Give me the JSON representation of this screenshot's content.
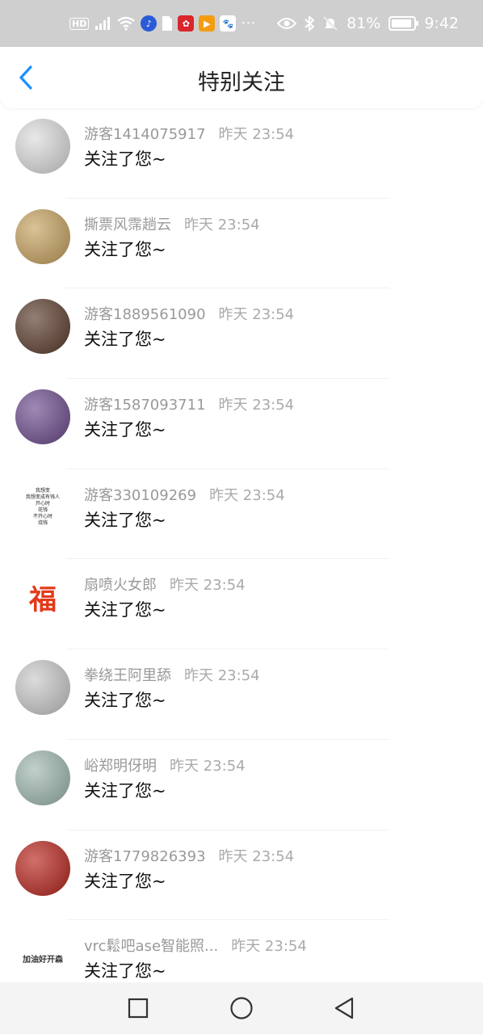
{
  "status_bar": {
    "left_icons": [
      "hd-icon",
      "signal-icon",
      "wifi-icon",
      "music-app-icon",
      "sim-icon",
      "huawei-app-icon",
      "video-app-icon",
      "baidu-app-icon"
    ],
    "hd_label": "HD",
    "more": "···",
    "battery": "81%",
    "time": "9:42"
  },
  "header": {
    "title": "特别关注"
  },
  "follows": [
    {
      "name": "游客1414075917",
      "time": "昨天 23:54",
      "message": "关注了您~",
      "avatar_color": "#dcdcdc"
    },
    {
      "name": "撕票风霈趟云",
      "time": "昨天 23:54",
      "message": "关注了您~",
      "avatar_color": "#c7a25e"
    },
    {
      "name": "游客1889561090",
      "time": "昨天 23:54",
      "message": "关注了您~",
      "avatar_color": "#5a3a2a"
    },
    {
      "name": "游客1587093711",
      "time": "昨天 23:54",
      "message": "关注了您~",
      "avatar_color": "#6b4a8c"
    },
    {
      "name": "游客330109269",
      "time": "昨天 23:54",
      "message": "关注了您~",
      "avatar_color": "#ffffff",
      "avatar_text": [
        "我想变",
        "我想变成有钱人",
        "开心时",
        "花钱",
        "不开心时",
        "烧钱"
      ]
    },
    {
      "name": "扇喷火女郎",
      "time": "昨天 23:54",
      "message": "关注了您~",
      "avatar_color": "#ffffff",
      "avatar_text": [
        "福"
      ]
    },
    {
      "name": "拳绕王阿里舔",
      "time": "昨天 23:54",
      "message": "关注了您~",
      "avatar_color": "#c9c9c9"
    },
    {
      "name": "峪郑明伢明",
      "time": "昨天 23:54",
      "message": "关注了您~",
      "avatar_color": "#9fb8b0"
    },
    {
      "name": "游客1779826393",
      "time": "昨天 23:54",
      "message": "关注了您~",
      "avatar_color": "#b8231b"
    },
    {
      "name": "vrc鬆吧ase智能照...",
      "time": "昨天 23:54",
      "message": "关注了您~",
      "avatar_color": "#ffffff",
      "avatar_text": [
        "加油好开森"
      ]
    }
  ],
  "nav": {
    "recent": "recents-square-icon",
    "home": "home-circle-icon",
    "back": "back-triangle-icon"
  },
  "colors": {
    "accent": "#1a90ff",
    "status_bar": "#cfcfcf",
    "name_gray": "#999999"
  }
}
